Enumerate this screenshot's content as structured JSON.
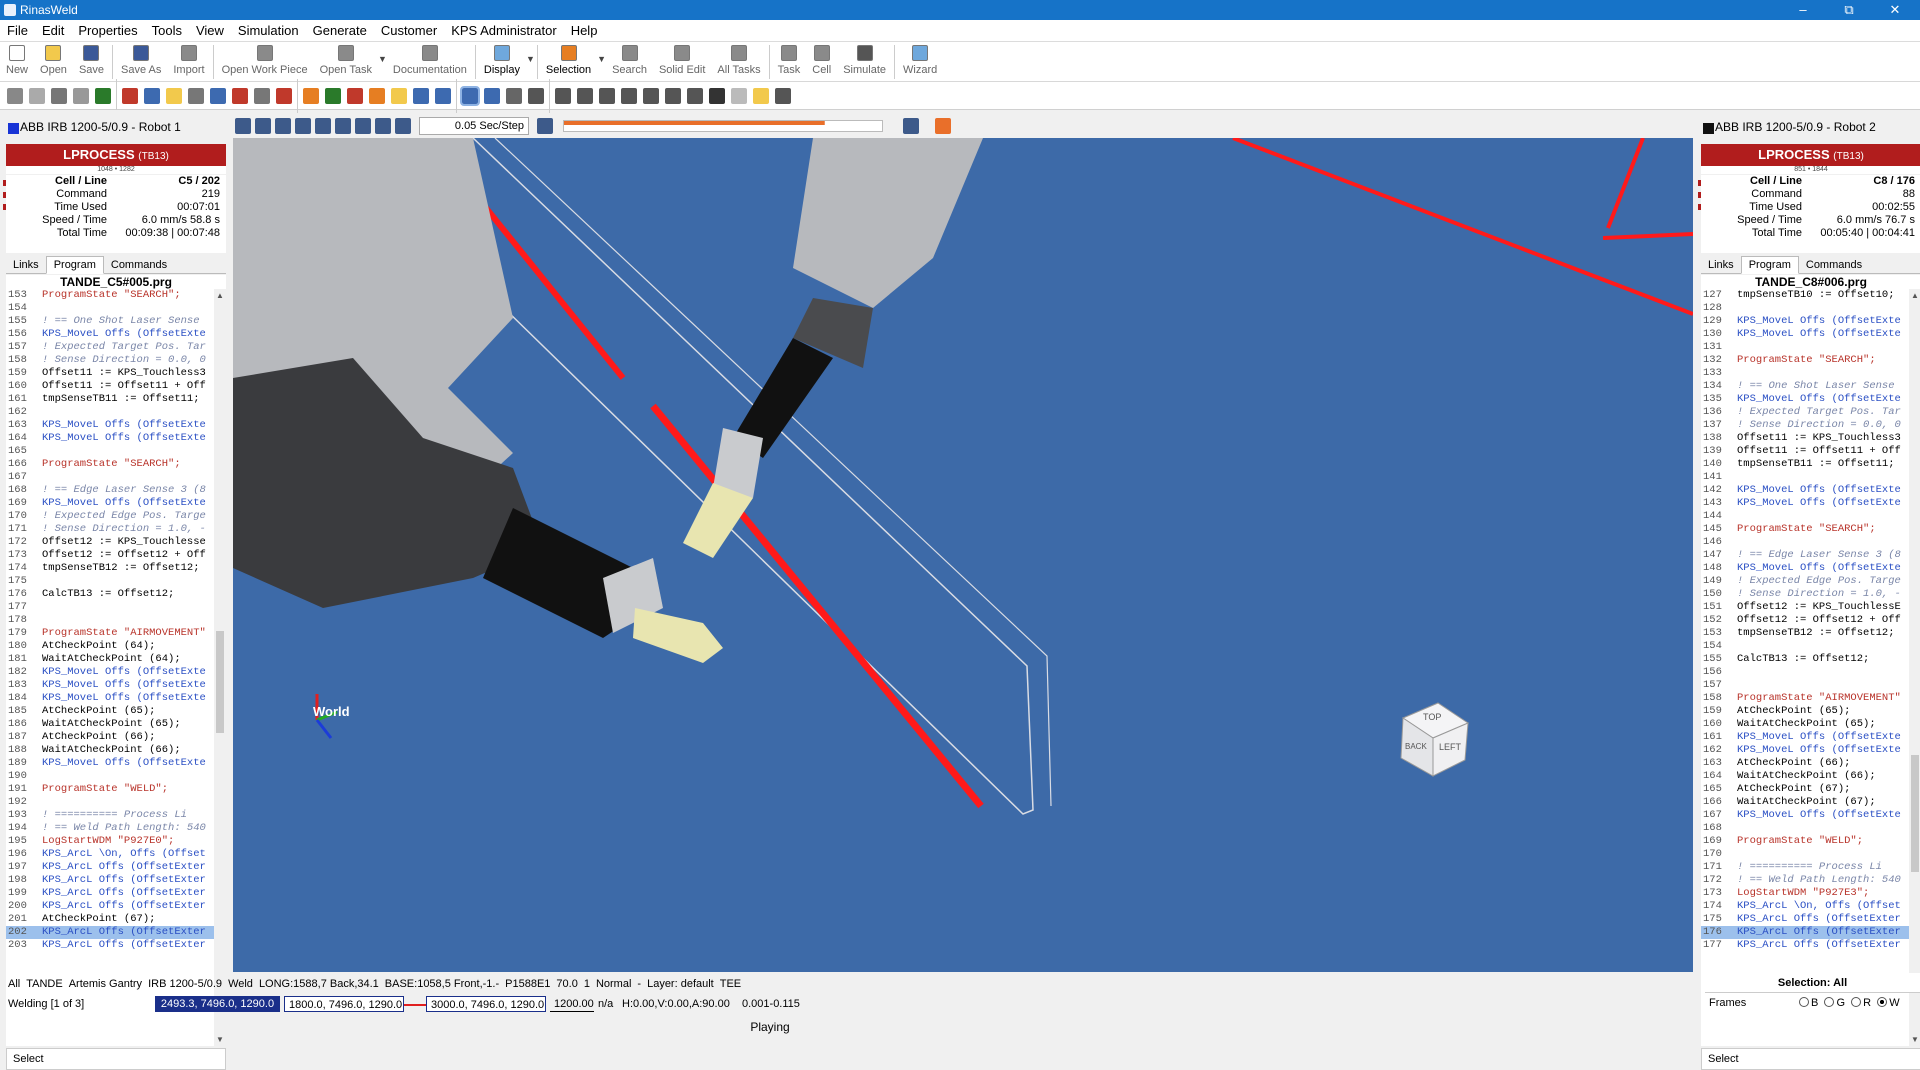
{
  "app": {
    "title": "RinasWeld"
  },
  "menu": [
    "File",
    "Edit",
    "Properties",
    "Tools",
    "View",
    "Simulation",
    "Generate",
    "Customer",
    "KPS Administrator",
    "Help"
  ],
  "toolbar": [
    {
      "label": "New",
      "color": "#ffffff"
    },
    {
      "label": "Open",
      "color": "#f2c94c"
    },
    {
      "label": "Save",
      "color": "#3b5998"
    },
    {
      "label": "Save As",
      "color": "#3b5998"
    },
    {
      "label": "Import",
      "color": "#8a8a8a"
    },
    {
      "label": "Open Work Piece",
      "color": "#8a8a8a"
    },
    {
      "label": "Open Task",
      "color": "#8a8a8a"
    },
    {
      "label": "Documentation",
      "color": "#8a8a8a"
    },
    {
      "label": "Display",
      "color": "#6fa8dc"
    },
    {
      "label": "Selection",
      "color": "#e67e22"
    },
    {
      "label": "Search",
      "color": "#8a8a8a"
    },
    {
      "label": "Solid Edit",
      "color": "#8a8a8a"
    },
    {
      "label": "All Tasks",
      "color": "#8a8a8a"
    },
    {
      "label": "Task",
      "color": "#8a8a8a"
    },
    {
      "label": "Cell",
      "color": "#8a8a8a"
    },
    {
      "label": "Simulate",
      "color": "#555555"
    },
    {
      "label": "Wizard",
      "color": "#6fa8dc"
    }
  ],
  "playback": {
    "step": "0.05 Sec/Step",
    "progress": 0.82
  },
  "robot1": {
    "name": "ABB IRB 1200-5/0.9 - Robot 1",
    "swatch": "#1834d6",
    "lprocess": "LPROCESS",
    "lprocess_tag": "(TB13)",
    "scale_text": "1048 • 1282",
    "stats": [
      {
        "k": "Cell / Line",
        "v": "C5 / 202"
      },
      {
        "k": "Command",
        "v": "219"
      },
      {
        "k": "Time Used",
        "v": "00:07:01"
      },
      {
        "k": "Speed / Time",
        "v": "6.0 mm/s  58.8 s"
      },
      {
        "k": "Total Time",
        "v": "00:09:38 | 00:07:48"
      }
    ],
    "tabs": [
      "Links",
      "Program",
      "Commands"
    ],
    "file": "TANDE_C5#005.prg",
    "select": "Select",
    "scroll": {
      "start": 0.45,
      "size": 0.14
    },
    "lines": [
      {
        "n": "153",
        "t": "ProgramState \"SEARCH\";",
        "c": "st"
      },
      {
        "n": "154",
        "t": "",
        "c": ""
      },
      {
        "n": "155",
        "t": "! == One Shot Laser Sense",
        "c": "cm"
      },
      {
        "n": "156",
        "t": "KPS_MoveL Offs (OffsetExte",
        "c": "kw"
      },
      {
        "n": "157",
        "t": "! Expected Target Pos. Tar",
        "c": "cm"
      },
      {
        "n": "158",
        "t": "! Sense Direction = 0.0, 0",
        "c": "cm"
      },
      {
        "n": "159",
        "t": "Offset11 := KPS_Touchless3",
        "c": ""
      },
      {
        "n": "160",
        "t": "Offset11 := Offset11 + Off",
        "c": ""
      },
      {
        "n": "161",
        "t": "tmpSenseTB11 := Offset11;",
        "c": ""
      },
      {
        "n": "162",
        "t": "",
        "c": ""
      },
      {
        "n": "163",
        "t": "KPS_MoveL Offs (OffsetExte",
        "c": "kw"
      },
      {
        "n": "164",
        "t": "KPS_MoveL Offs (OffsetExte",
        "c": "kw"
      },
      {
        "n": "165",
        "t": "",
        "c": ""
      },
      {
        "n": "166",
        "t": "ProgramState \"SEARCH\";",
        "c": "st"
      },
      {
        "n": "167",
        "t": "",
        "c": ""
      },
      {
        "n": "168",
        "t": "! == Edge Laser Sense 3 (8",
        "c": "cm"
      },
      {
        "n": "169",
        "t": "KPS_MoveL Offs (OffsetExte",
        "c": "kw"
      },
      {
        "n": "170",
        "t": "! Expected Edge Pos. Targe",
        "c": "cm"
      },
      {
        "n": "171",
        "t": "! Sense Direction = 1.0, -",
        "c": "cm"
      },
      {
        "n": "172",
        "t": "Offset12 := KPS_Touchlesse",
        "c": ""
      },
      {
        "n": "173",
        "t": "Offset12 := Offset12 + Off",
        "c": ""
      },
      {
        "n": "174",
        "t": "tmpSenseTB12 := Offset12;",
        "c": ""
      },
      {
        "n": "175",
        "t": "",
        "c": ""
      },
      {
        "n": "176",
        "t": "CalcTB13 := Offset12;",
        "c": ""
      },
      {
        "n": "177",
        "t": "",
        "c": ""
      },
      {
        "n": "178",
        "t": "",
        "c": ""
      },
      {
        "n": "179",
        "t": "ProgramState \"AIRMOVEMENT\"",
        "c": "st"
      },
      {
        "n": "180",
        "t": "AtCheckPoint (64);",
        "c": ""
      },
      {
        "n": "181",
        "t": "WaitAtCheckPoint (64);",
        "c": ""
      },
      {
        "n": "182",
        "t": "KPS_MoveL Offs (OffsetExte",
        "c": "kw"
      },
      {
        "n": "183",
        "t": "KPS_MoveL Offs (OffsetExte",
        "c": "kw"
      },
      {
        "n": "184",
        "t": "KPS_MoveL Offs (OffsetExte",
        "c": "kw"
      },
      {
        "n": "185",
        "t": "AtCheckPoint (65);",
        "c": ""
      },
      {
        "n": "186",
        "t": "WaitAtCheckPoint (65);",
        "c": ""
      },
      {
        "n": "187",
        "t": "AtCheckPoint (66);",
        "c": ""
      },
      {
        "n": "188",
        "t": "WaitAtCheckPoint (66);",
        "c": ""
      },
      {
        "n": "189",
        "t": "KPS_MoveL Offs (OffsetExte",
        "c": "kw"
      },
      {
        "n": "190",
        "t": "",
        "c": ""
      },
      {
        "n": "191",
        "t": "ProgramState \"WELD\";",
        "c": "st"
      },
      {
        "n": "192",
        "t": "",
        "c": ""
      },
      {
        "n": "193",
        "t": "! ==========  Process Li",
        "c": "cm"
      },
      {
        "n": "194",
        "t": "! == Weld Path Length: 540",
        "c": "cm"
      },
      {
        "n": "195",
        "t": "LogStartWDM \"P927E0\";",
        "c": "st"
      },
      {
        "n": "196",
        "t": "KPS_ArcL \\On, Offs (Offset",
        "c": "kw"
      },
      {
        "n": "197",
        "t": "KPS_ArcL Offs (OffsetExter",
        "c": "kw"
      },
      {
        "n": "198",
        "t": "KPS_ArcL Offs (OffsetExter",
        "c": "kw"
      },
      {
        "n": "199",
        "t": "KPS_ArcL Offs (OffsetExter",
        "c": "kw"
      },
      {
        "n": "200",
        "t": "KPS_ArcL Offs (OffsetExter",
        "c": "kw"
      },
      {
        "n": "201",
        "t": "AtCheckPoint (67);",
        "c": ""
      },
      {
        "n": "202",
        "t": "KPS_ArcL Offs (OffsetExter",
        "c": "kw",
        "hl": true
      },
      {
        "n": "203",
        "t": "KPS_ArcL Offs (OffsetExter",
        "c": "kw"
      }
    ]
  },
  "robot2": {
    "name": "ABB IRB 1200-5/0.9 - Robot 2",
    "swatch": "#111111",
    "lprocess": "LPROCESS",
    "lprocess_tag": "(TB13)",
    "scale_text": "851 • 1844",
    "stats": [
      {
        "k": "Cell / Line",
        "v": "C8 / 176"
      },
      {
        "k": "Command",
        "v": "88"
      },
      {
        "k": "Time Used",
        "v": "00:02:55"
      },
      {
        "k": "Speed / Time",
        "v": "6.0 mm/s  76.7 s"
      },
      {
        "k": "Total Time",
        "v": "00:05:40 | 00:04:41"
      }
    ],
    "tabs": [
      "Links",
      "Program",
      "Commands"
    ],
    "file": "TANDE_C8#006.prg",
    "select": "Select",
    "scroll": {
      "start": 0.62,
      "size": 0.16
    },
    "lines": [
      {
        "n": "127",
        "t": "tmpSenseTB10 := Offset10;",
        "c": ""
      },
      {
        "n": "128",
        "t": "",
        "c": ""
      },
      {
        "n": "129",
        "t": "KPS_MoveL Offs (OffsetExte",
        "c": "kw"
      },
      {
        "n": "130",
        "t": "KPS_MoveL Offs (OffsetExte",
        "c": "kw"
      },
      {
        "n": "131",
        "t": "",
        "c": ""
      },
      {
        "n": "132",
        "t": "ProgramState \"SEARCH\";",
        "c": "st"
      },
      {
        "n": "133",
        "t": "",
        "c": ""
      },
      {
        "n": "134",
        "t": "! == One Shot Laser Sense",
        "c": "cm"
      },
      {
        "n": "135",
        "t": "KPS_MoveL Offs (OffsetExte",
        "c": "kw"
      },
      {
        "n": "136",
        "t": "! Expected Target Pos. Tar",
        "c": "cm"
      },
      {
        "n": "137",
        "t": "! Sense Direction = 0.0, 0",
        "c": "cm"
      },
      {
        "n": "138",
        "t": "Offset11 := KPS_Touchless3",
        "c": ""
      },
      {
        "n": "139",
        "t": "Offset11 := Offset11 + Off",
        "c": ""
      },
      {
        "n": "140",
        "t": "tmpSenseTB11 := Offset11;",
        "c": ""
      },
      {
        "n": "141",
        "t": "",
        "c": ""
      },
      {
        "n": "142",
        "t": "KPS_MoveL Offs (OffsetExte",
        "c": "kw"
      },
      {
        "n": "143",
        "t": "KPS_MoveL Offs (OffsetExte",
        "c": "kw"
      },
      {
        "n": "144",
        "t": "",
        "c": ""
      },
      {
        "n": "145",
        "t": "ProgramState \"SEARCH\";",
        "c": "st"
      },
      {
        "n": "146",
        "t": "",
        "c": ""
      },
      {
        "n": "147",
        "t": "! == Edge Laser Sense 3 (8",
        "c": "cm"
      },
      {
        "n": "148",
        "t": "KPS_MoveL Offs (OffsetExte",
        "c": "kw"
      },
      {
        "n": "149",
        "t": "! Expected Edge Pos. Targe",
        "c": "cm"
      },
      {
        "n": "150",
        "t": "! Sense Direction = 1.0, -",
        "c": "cm"
      },
      {
        "n": "151",
        "t": "Offset12 := KPS_TouchlessE",
        "c": ""
      },
      {
        "n": "152",
        "t": "Offset12 := Offset12 + Off",
        "c": ""
      },
      {
        "n": "153",
        "t": "tmpSenseTB12 := Offset12;",
        "c": ""
      },
      {
        "n": "154",
        "t": "",
        "c": ""
      },
      {
        "n": "155",
        "t": "CalcTB13 := Offset12;",
        "c": ""
      },
      {
        "n": "156",
        "t": "",
        "c": ""
      },
      {
        "n": "157",
        "t": "",
        "c": ""
      },
      {
        "n": "158",
        "t": "ProgramState \"AIRMOVEMENT\"",
        "c": "st"
      },
      {
        "n": "159",
        "t": "AtCheckPoint (65);",
        "c": ""
      },
      {
        "n": "160",
        "t": "WaitAtCheckPoint (65);",
        "c": ""
      },
      {
        "n": "161",
        "t": "KPS_MoveL Offs (OffsetExte",
        "c": "kw"
      },
      {
        "n": "162",
        "t": "KPS_MoveL Offs (OffsetExte",
        "c": "kw"
      },
      {
        "n": "163",
        "t": "AtCheckPoint (66);",
        "c": ""
      },
      {
        "n": "164",
        "t": "WaitAtCheckPoint (66);",
        "c": ""
      },
      {
        "n": "165",
        "t": "AtCheckPoint (67);",
        "c": ""
      },
      {
        "n": "166",
        "t": "WaitAtCheckPoint (67);",
        "c": ""
      },
      {
        "n": "167",
        "t": "KPS_MoveL Offs (OffsetExte",
        "c": "kw"
      },
      {
        "n": "168",
        "t": "",
        "c": ""
      },
      {
        "n": "169",
        "t": "ProgramState \"WELD\";",
        "c": "st"
      },
      {
        "n": "170",
        "t": "",
        "c": ""
      },
      {
        "n": "171",
        "t": "! ==========  Process Li",
        "c": "cm"
      },
      {
        "n": "172",
        "t": "! == Weld Path Length: 540",
        "c": "cm"
      },
      {
        "n": "173",
        "t": "LogStartWDM \"P927E3\";",
        "c": "st"
      },
      {
        "n": "174",
        "t": "KPS_ArcL \\On, Offs (Offset",
        "c": "kw"
      },
      {
        "n": "175",
        "t": "KPS_ArcL Offs (OffsetExter",
        "c": "kw"
      },
      {
        "n": "176",
        "t": "KPS_ArcL Offs (OffsetExter",
        "c": "kw",
        "hl": true
      },
      {
        "n": "177",
        "t": "KPS_ArcL Offs (OffsetExter",
        "c": "kw"
      }
    ]
  },
  "viewport": {
    "axis_label": "World",
    "cube": [
      "TOP",
      "BACK",
      "LEFT"
    ]
  },
  "status": {
    "line1": [
      "All",
      "TANDE",
      "Artemis Gantry",
      "IRB 1200-5/0.9",
      "Weld",
      "LONG:1588,7 Back,34.1",
      "BASE:1058,5 Front,-1.-",
      "P1588E1",
      "70.0",
      "1",
      "Normal",
      "-",
      "Layer: default",
      "TEE"
    ],
    "welding": "Welding [1 of 3]",
    "coord1": "2493.3, 7496.0, 1290.0",
    "coord2": "1800.0, 7496.0, 1290.0",
    "coord3": "3000.0, 7496.0, 1290.0",
    "coord4": "1200.00",
    "na": "n/a",
    "hvr": "H:0.00,V:0.00,A:90.00",
    "range": "0.001-0.115",
    "playing": "Playing",
    "selection": "Selection: All",
    "frames": "Frames",
    "radios": [
      "B",
      "G",
      "R",
      "W"
    ]
  }
}
